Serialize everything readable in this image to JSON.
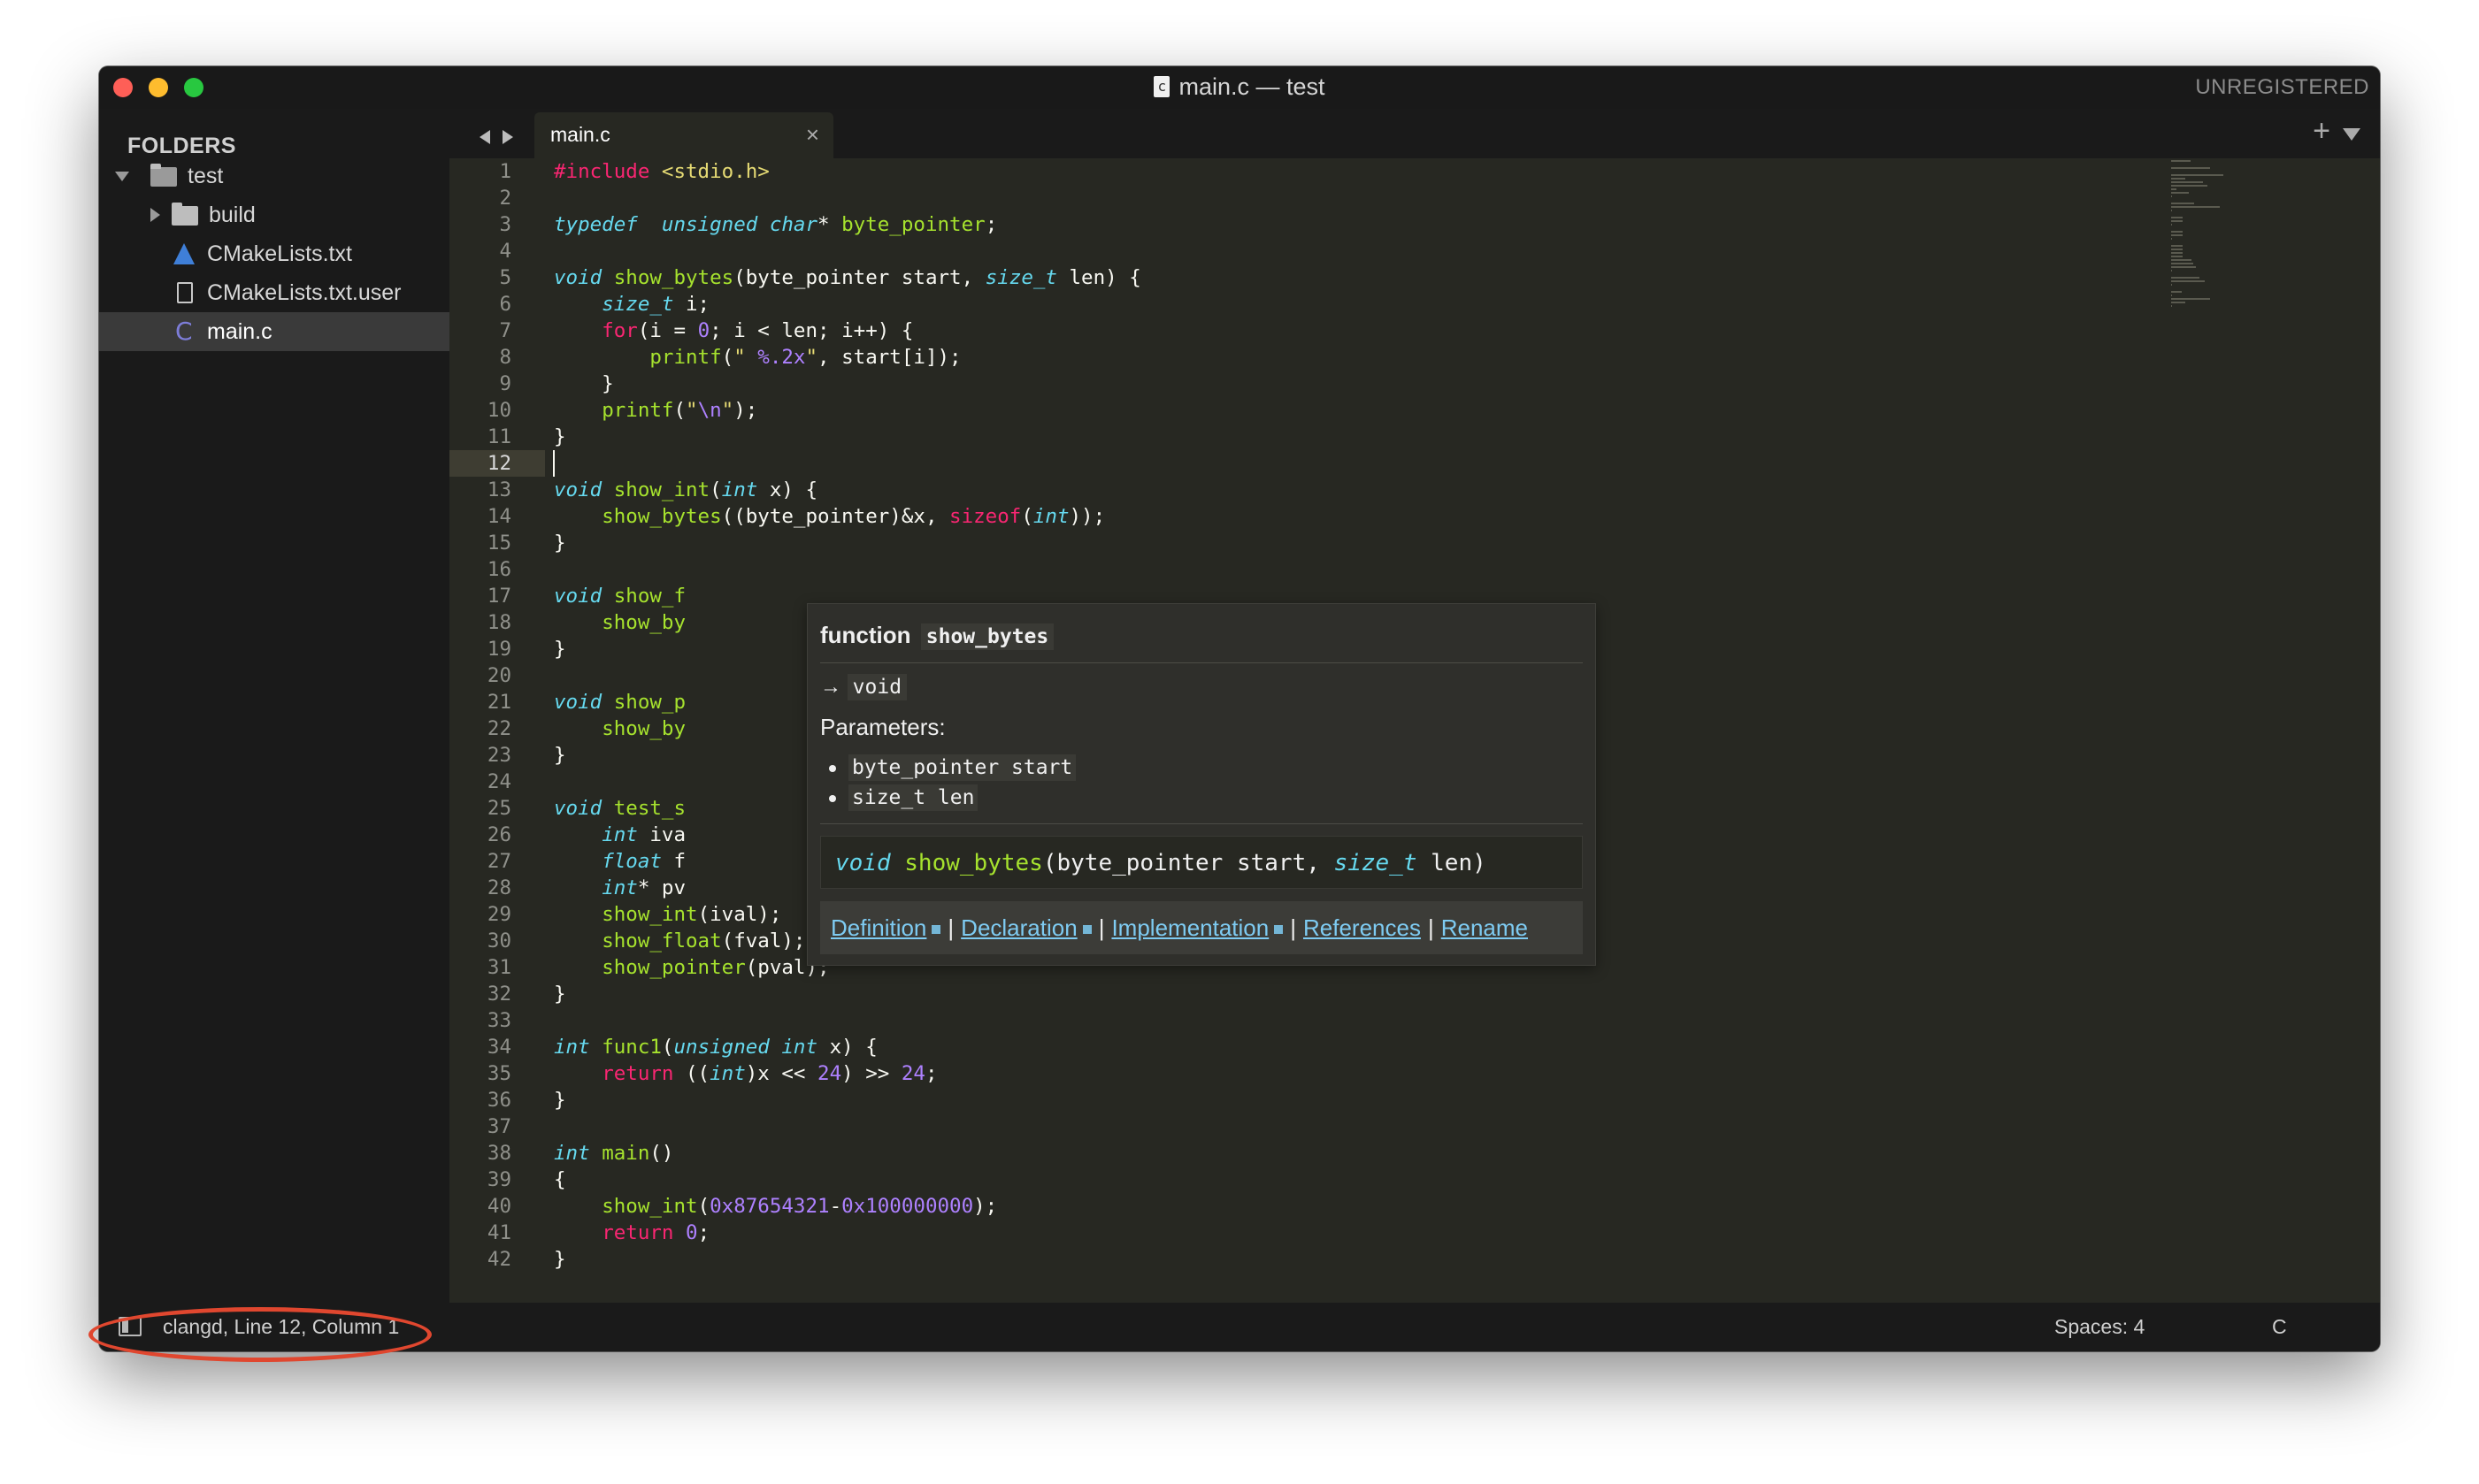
{
  "window": {
    "title": "main.c — test",
    "license_status": "UNREGISTERED"
  },
  "sidebar": {
    "header": "FOLDERS",
    "items": [
      {
        "label": "test",
        "icon": "folder-open-icon",
        "expanded": true
      },
      {
        "label": "build",
        "icon": "folder-icon",
        "expanded": false
      },
      {
        "label": "CMakeLists.txt",
        "icon": "cmake-icon"
      },
      {
        "label": "CMakeLists.txt.user",
        "icon": "file-icon"
      },
      {
        "label": "main.c",
        "icon": "c-file-icon",
        "selected": true
      }
    ]
  },
  "tabs": {
    "active": "main.c",
    "close_glyph": "×",
    "new_tab_glyph": "+"
  },
  "editor": {
    "current_line": 12,
    "lines": [
      {
        "n": "1"
      },
      {
        "n": "2"
      },
      {
        "n": "3"
      },
      {
        "n": "4"
      },
      {
        "n": "5"
      },
      {
        "n": "6"
      },
      {
        "n": "7"
      },
      {
        "n": "8"
      },
      {
        "n": "9"
      },
      {
        "n": "10"
      },
      {
        "n": "11"
      },
      {
        "n": "12"
      },
      {
        "n": "13"
      },
      {
        "n": "14"
      },
      {
        "n": "15"
      },
      {
        "n": "16"
      },
      {
        "n": "17"
      },
      {
        "n": "18"
      },
      {
        "n": "19"
      },
      {
        "n": "20"
      },
      {
        "n": "21"
      },
      {
        "n": "22"
      },
      {
        "n": "23"
      },
      {
        "n": "24"
      },
      {
        "n": "25"
      },
      {
        "n": "26"
      },
      {
        "n": "27"
      },
      {
        "n": "28"
      },
      {
        "n": "29"
      },
      {
        "n": "30"
      },
      {
        "n": "31"
      },
      {
        "n": "32"
      },
      {
        "n": "33"
      },
      {
        "n": "34"
      },
      {
        "n": "35"
      },
      {
        "n": "36"
      },
      {
        "n": "37"
      },
      {
        "n": "38"
      },
      {
        "n": "39"
      },
      {
        "n": "40"
      },
      {
        "n": "41"
      },
      {
        "n": "42"
      }
    ],
    "code": [
      [
        [
          "kw",
          "#include "
        ],
        [
          "st",
          "<stdio.h>"
        ]
      ],
      [],
      [
        [
          "ty",
          "typedef"
        ],
        [
          "",
          "  "
        ],
        [
          "ty",
          "unsigned"
        ],
        [
          "",
          " "
        ],
        [
          "ty",
          "char"
        ],
        [
          "",
          "* "
        ],
        [
          "fn",
          "byte_pointer"
        ],
        [
          "",
          ";"
        ]
      ],
      [],
      [
        [
          "ty",
          "void"
        ],
        [
          "",
          " "
        ],
        [
          "fn",
          "show_bytes"
        ],
        [
          "",
          "(byte_pointer start, "
        ],
        [
          "ty",
          "size_t"
        ],
        [
          "",
          " len) {"
        ]
      ],
      [
        [
          "",
          "    "
        ],
        [
          "ty",
          "size_t"
        ],
        [
          "",
          " i;"
        ]
      ],
      [
        [
          "",
          "    "
        ],
        [
          "kw",
          "for"
        ],
        [
          "",
          "(i = "
        ],
        [
          "nu",
          "0"
        ],
        [
          "",
          "; i < len; i++) {"
        ]
      ],
      [
        [
          "",
          "        "
        ],
        [
          "fn",
          "printf"
        ],
        [
          "",
          "("
        ],
        [
          "st",
          "\" "
        ],
        [
          "nu",
          "%.2x"
        ],
        [
          "st",
          "\""
        ],
        [
          "",
          ", start[i]);"
        ]
      ],
      [
        [
          "",
          "    }"
        ]
      ],
      [
        [
          "",
          "    "
        ],
        [
          "fn",
          "printf"
        ],
        [
          "",
          "("
        ],
        [
          "st",
          "\""
        ],
        [
          "esc",
          "\\n"
        ],
        [
          "st",
          "\""
        ],
        [
          "",
          ");"
        ]
      ],
      [
        [
          "",
          "}"
        ]
      ],
      [],
      [
        [
          "ty",
          "void"
        ],
        [
          "",
          " "
        ],
        [
          "fn",
          "show_int"
        ],
        [
          "",
          "("
        ],
        [
          "ty",
          "int"
        ],
        [
          "",
          " x) {"
        ]
      ],
      [
        [
          "",
          "    "
        ],
        [
          "fn",
          "show_bytes"
        ],
        [
          "",
          "((byte_pointer)&x, "
        ],
        [
          "kw",
          "sizeof"
        ],
        [
          "",
          "("
        ],
        [
          "ty",
          "int"
        ],
        [
          "",
          "));"
        ]
      ],
      [
        [
          "",
          "}"
        ]
      ],
      [],
      [
        [
          "ty",
          "void"
        ],
        [
          "",
          " "
        ],
        [
          "fn",
          "show_f"
        ]
      ],
      [
        [
          "",
          "    "
        ],
        [
          "fn",
          "show_by"
        ]
      ],
      [
        [
          "",
          "}"
        ]
      ],
      [],
      [
        [
          "ty",
          "void"
        ],
        [
          "",
          " "
        ],
        [
          "fn",
          "show_p"
        ]
      ],
      [
        [
          "",
          "    "
        ],
        [
          "fn",
          "show_by"
        ]
      ],
      [
        [
          "",
          "}"
        ]
      ],
      [],
      [
        [
          "ty",
          "void"
        ],
        [
          "",
          " "
        ],
        [
          "fn",
          "test_s"
        ]
      ],
      [
        [
          "",
          "    "
        ],
        [
          "ty",
          "int"
        ],
        [
          "",
          " iva"
        ]
      ],
      [
        [
          "",
          "    "
        ],
        [
          "ty",
          "float"
        ],
        [
          "",
          " f"
        ]
      ],
      [
        [
          "",
          "    "
        ],
        [
          "ty",
          "int"
        ],
        [
          "",
          "* pv"
        ]
      ],
      [
        [
          "",
          "    "
        ],
        [
          "fn",
          "show_int"
        ],
        [
          "",
          "(ival);"
        ]
      ],
      [
        [
          "",
          "    "
        ],
        [
          "fn",
          "show_float"
        ],
        [
          "",
          "(fval);"
        ]
      ],
      [
        [
          "",
          "    "
        ],
        [
          "fn",
          "show_pointer"
        ],
        [
          "",
          "(pval);"
        ]
      ],
      [
        [
          "",
          "}"
        ]
      ],
      [],
      [
        [
          "ty",
          "int"
        ],
        [
          "",
          " "
        ],
        [
          "fn",
          "func1"
        ],
        [
          "",
          "("
        ],
        [
          "ty",
          "unsigned"
        ],
        [
          "",
          " "
        ],
        [
          "ty",
          "int"
        ],
        [
          "",
          " x) {"
        ]
      ],
      [
        [
          "",
          "    "
        ],
        [
          "kw",
          "return"
        ],
        [
          "",
          " (("
        ],
        [
          "ty",
          "int"
        ],
        [
          "",
          ")x << "
        ],
        [
          "nu",
          "24"
        ],
        [
          "",
          ") >> "
        ],
        [
          "nu",
          "24"
        ],
        [
          "",
          ";"
        ]
      ],
      [
        [
          "",
          "}"
        ]
      ],
      [],
      [
        [
          "ty",
          "int"
        ],
        [
          "",
          " "
        ],
        [
          "fn",
          "main"
        ],
        [
          "",
          "()"
        ]
      ],
      [
        [
          "",
          "{"
        ]
      ],
      [
        [
          "",
          "    "
        ],
        [
          "fn",
          "show_int"
        ],
        [
          "",
          "("
        ],
        [
          "nu",
          "0x87654321"
        ],
        [
          "",
          "-"
        ],
        [
          "nu",
          "0x100000000"
        ],
        [
          "",
          ");"
        ]
      ],
      [
        [
          "",
          "    "
        ],
        [
          "kw",
          "return"
        ],
        [
          "",
          " "
        ],
        [
          "nu",
          "0"
        ],
        [
          "",
          ";"
        ]
      ],
      [
        [
          "",
          "}"
        ]
      ]
    ]
  },
  "hover_popup": {
    "kind": "function",
    "name": "show_bytes",
    "returns_arrow": "→",
    "returns_type": "void",
    "params_label": "Parameters:",
    "params": [
      "byte_pointer start",
      "size_t len"
    ],
    "signature": [
      [
        "ty",
        "void"
      ],
      [
        "",
        " "
      ],
      [
        "fn",
        "show_bytes"
      ],
      [
        "",
        "(byte_pointer start, "
      ],
      [
        "ty",
        "size_t"
      ],
      [
        "",
        " len)"
      ]
    ],
    "links": [
      "Definition",
      "Declaration",
      "Implementation",
      "References",
      "Rename"
    ],
    "separator": "|"
  },
  "statusbar": {
    "position_text": "clangd, Line 12, Column 1",
    "indentation": "Spaces: 4",
    "syntax": "C"
  },
  "colors": {
    "editor_bg": "#272822",
    "sidebar_bg": "#1a1a1a",
    "keyword": "#f92672",
    "type": "#66d9ef",
    "function": "#a6e22e",
    "string": "#e6db74",
    "number": "#ae81ff",
    "link": "#7ecbf2",
    "annotation": "#e0472f"
  }
}
